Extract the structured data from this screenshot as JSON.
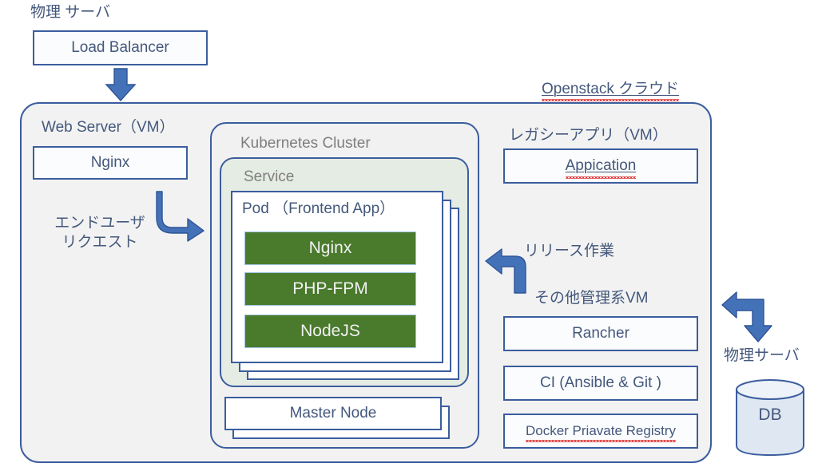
{
  "diagram": {
    "title_physical_server_top": "物理 サーバ",
    "title_openstack_cloud": "Openstack クラウド",
    "title_physical_server_right": "物理サーバ"
  },
  "load_balancer": {
    "label": "Load Balancer"
  },
  "web_server": {
    "title": "Web Server（VM）",
    "nginx_label": "Nginx",
    "enduser_line1": "エンドユーザ",
    "enduser_line2": "リクエスト"
  },
  "kubernetes": {
    "cluster_title": "Kubernetes Cluster",
    "service_title": "Service",
    "pod_title": "Pod （Frontend App）",
    "containers": [
      "Nginx",
      "PHP-FPM",
      "NodeJS"
    ],
    "master_node_label": "Master Node"
  },
  "legacy_app": {
    "title": "レガシーアプリ（VM）",
    "app_label": "Appication"
  },
  "management": {
    "release_label": "リリース作業",
    "title": "その他管理系VM",
    "items": [
      "Rancher",
      "CI (Ansible & Git )",
      "Docker Priavate Registry"
    ]
  },
  "database": {
    "label": "DB"
  },
  "icons": {
    "arrow_down": "arrow-down-icon",
    "arrow_bend_down_right": "arrow-bend-down-right-icon",
    "arrow_bend_left": "arrow-bend-left-icon",
    "arrow_bend_left_down": "arrow-bend-left-down-icon",
    "database_cylinder": "database-cylinder-icon"
  },
  "colors": {
    "border_blue": "#3b5d9e",
    "arrow_blue": "#4472b8",
    "arrow_blue_dark": "#2f5496",
    "text_blue": "#44587c",
    "title_gray": "#7e7e7e",
    "green_block": "#4a7a2c",
    "container_gray": "#f2f2f2",
    "service_green_tint": "#e5ece3",
    "db_fill": "#dfe7f2",
    "spell_error": "#e03030"
  }
}
